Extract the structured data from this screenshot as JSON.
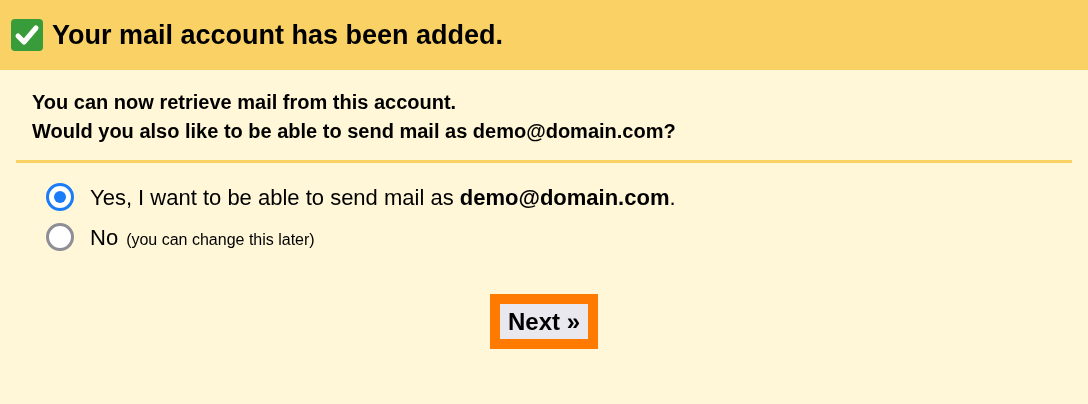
{
  "header": {
    "title": "Your mail account has been added."
  },
  "intro": [
    "You can now retrieve mail from this account.",
    "Would you also like to be able to send mail as demo@domain.com?"
  ],
  "options": [
    {
      "label": "Yes, I want to be able to send mail as **demo@domain.com**.",
      "selected": true
    },
    {
      "label": "No",
      "hint": "(you can change this later)",
      "selected": false
    }
  ],
  "button": {
    "label": "Next »",
    "focused": true
  }
}
